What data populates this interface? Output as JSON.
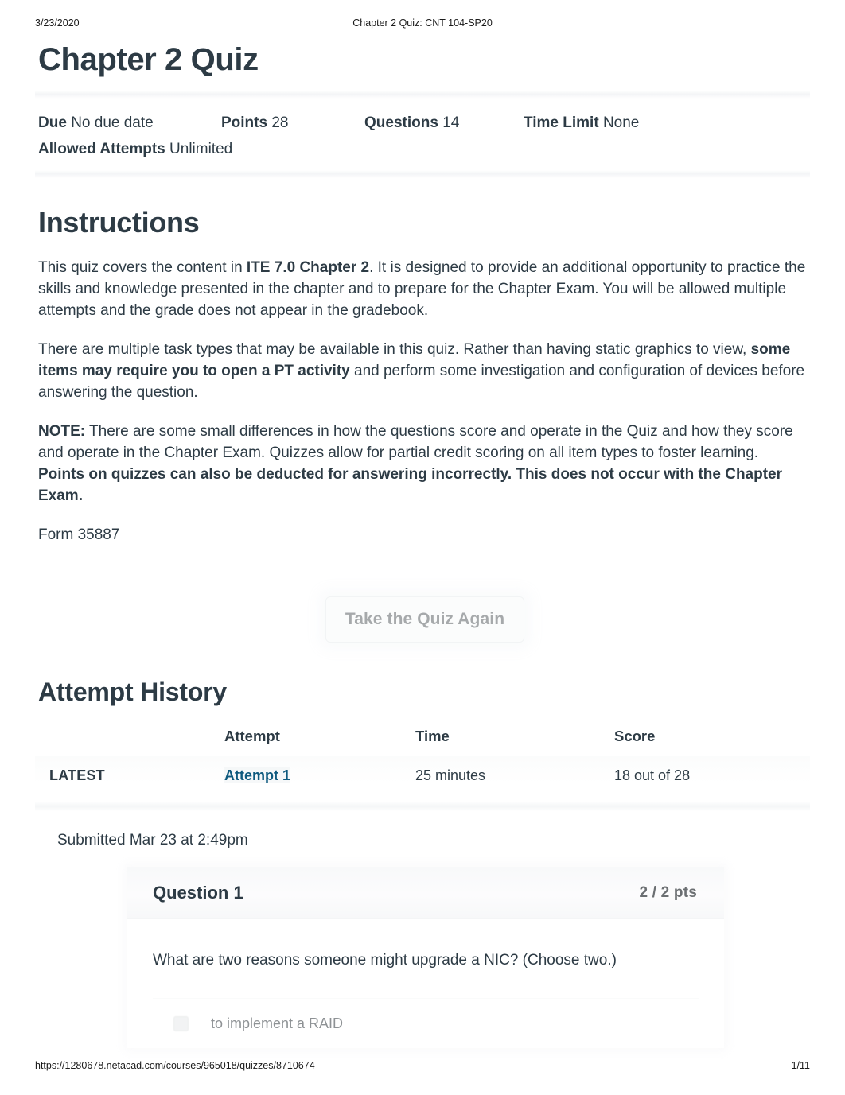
{
  "print": {
    "date": "3/23/2020",
    "document_title": "Chapter 2 Quiz: CNT 104-SP20",
    "url": "https://1280678.netacad.com/courses/965018/quizzes/8710674",
    "page_number": "1/11"
  },
  "quiz": {
    "title": "Chapter 2 Quiz",
    "details": [
      {
        "label": "Due",
        "value": "No due date"
      },
      {
        "label": "Points",
        "value": "28"
      },
      {
        "label": "Questions",
        "value": "14"
      },
      {
        "label": "Time Limit",
        "value": "None"
      },
      {
        "label": "Allowed Attempts",
        "value": "Unlimited"
      }
    ]
  },
  "instructions": {
    "heading": "Instructions",
    "p1_a": "This quiz covers the content in ",
    "p1_b": "ITE 7.0 Chapter 2",
    "p1_c": ". It is designed to provide an additional opportunity to practice the skills and knowledge presented in the chapter and to prepare for the Chapter Exam. You will be allowed multiple attempts and the grade does not appear in the gradebook.",
    "p2_a": "There are multiple task types that may be available in this quiz. Rather than having static graphics to view, ",
    "p2_b": "some items may require you to open a PT activity",
    "p2_c": " and perform some investigation and configuration of devices before answering the question.",
    "p3_a": "NOTE:",
    "p3_b": " There are some small differences in how the questions score and operate in the Quiz and how they score and operate in the Chapter Exam. Quizzes allow for partial credit scoring on all item types to foster learning. ",
    "p3_c": "Points on quizzes can also be deducted for answering incorrectly. This does not occur with the Chapter Exam.",
    "form": "Form 35887"
  },
  "retake_button": {
    "label": "Take the Quiz Again"
  },
  "attempt_history": {
    "heading": "Attempt History",
    "columns": [
      "",
      "Attempt",
      "Time",
      "Score"
    ],
    "rows": [
      {
        "latest": "LATEST",
        "attempt": "Attempt 1",
        "time": "25 minutes",
        "score": "18 out of 28"
      }
    ]
  },
  "submission": {
    "submitted_label": "Submitted Mar 23 at 2:49pm"
  },
  "question": {
    "title": "Question 1",
    "points": "2 / 2 pts",
    "text": "What are two reasons someone might upgrade a NIC? (Choose two.)",
    "answers": [
      {
        "text": "to implement a RAID"
      }
    ]
  },
  "colors": {
    "link": "#0e5a7e",
    "text": "#2d3b45",
    "muted": "#8e9295",
    "card_header": "#f8f9fa"
  }
}
